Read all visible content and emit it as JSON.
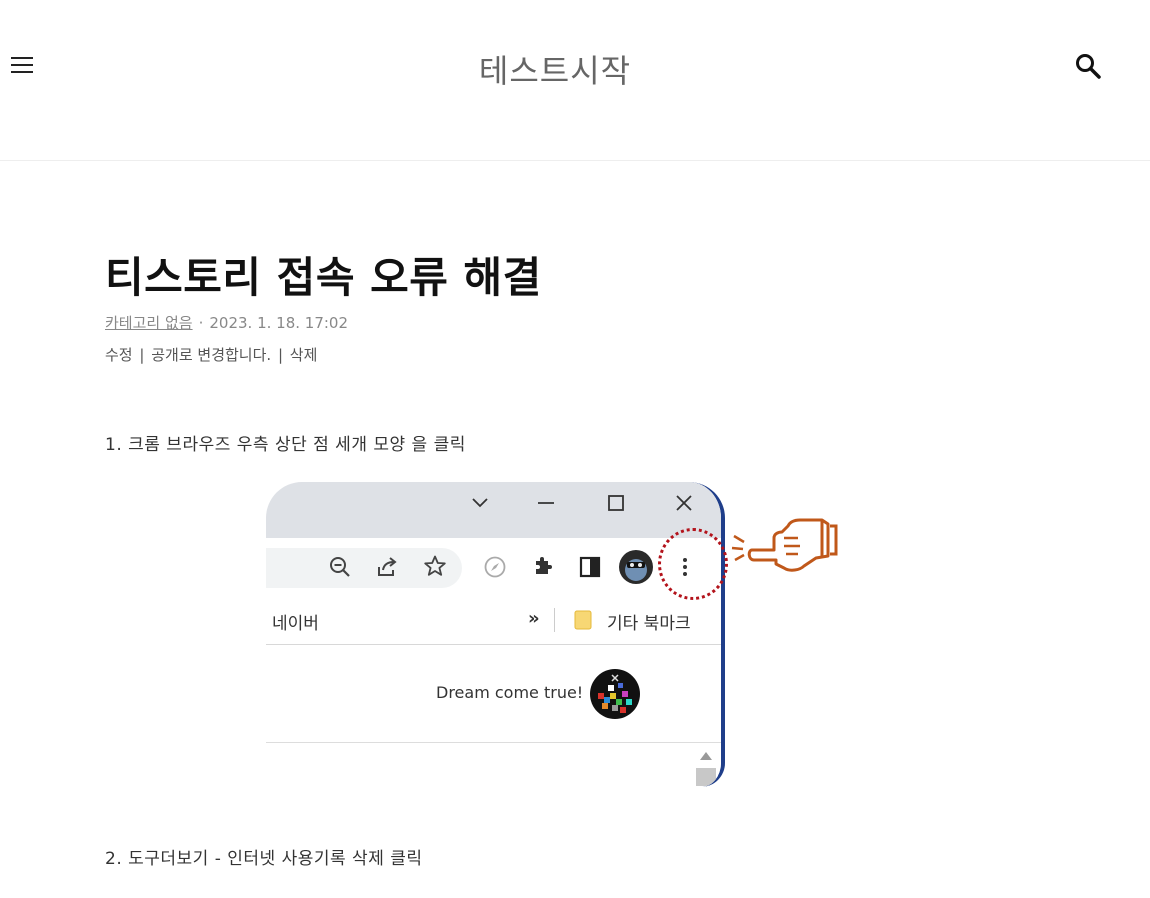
{
  "header": {
    "site_title": "테스트시작"
  },
  "post": {
    "title": "티스토리 접속 오류 해결",
    "category": "카테고리 없음",
    "separator": "·",
    "date": "2023. 1. 18. 17:02",
    "admin": {
      "edit": "수정",
      "publish": "공개로 변경합니다.",
      "delete": "삭제",
      "sep": "|"
    },
    "step1": "1. 크롬 브라우즈 우측 상단 점 세개 모양 을 클릭",
    "step2": "2. 도구더보기 - 인터넷 사용기록 삭제  클릭"
  },
  "screenshot": {
    "bookmark_naver": "네이버",
    "bookmark_more": "»",
    "bookmark_other": "기타 북마크",
    "page_text": "Dream come true!"
  },
  "colors": {
    "highlight": "#b3131b",
    "hand": "#c0581a",
    "border_blue": "#1f3e8a"
  }
}
